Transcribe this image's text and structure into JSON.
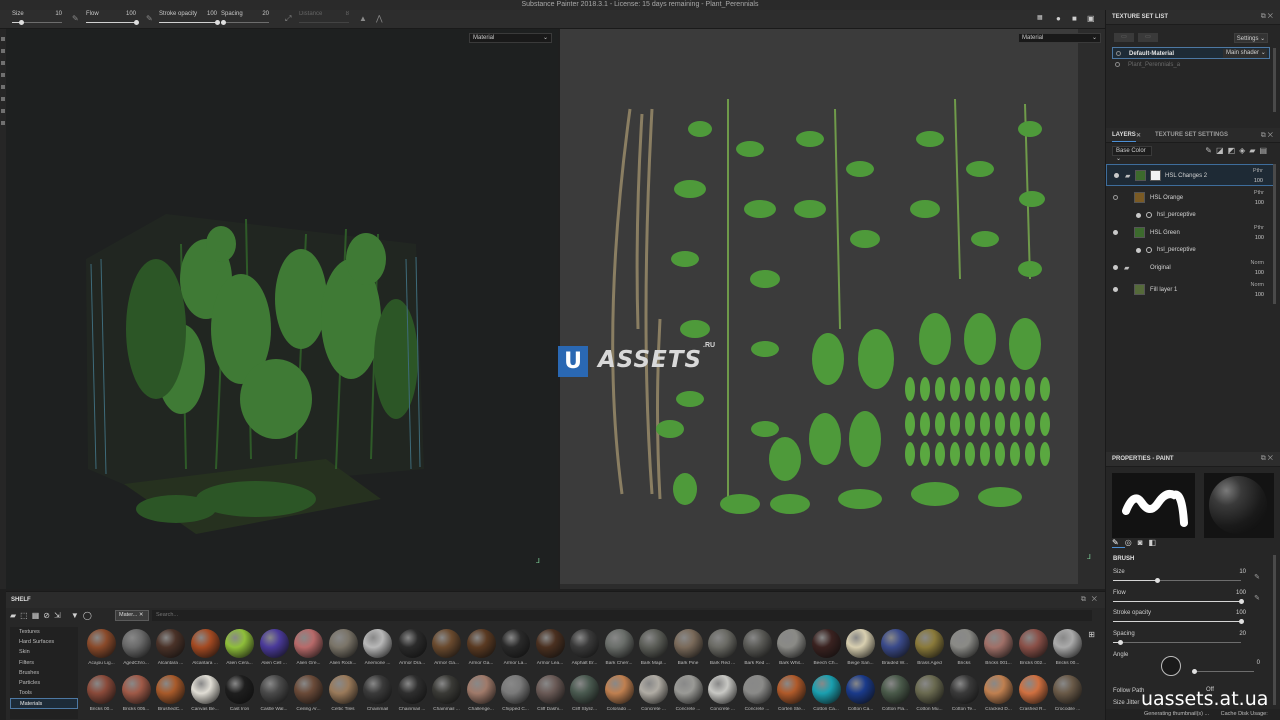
{
  "window": {
    "title": "Substance Painter 2018.3.1 - License: 15 days remaining - Plant_Perennials"
  },
  "toolbar": {
    "size": {
      "label": "Size",
      "value": "10",
      "fraction": 0.18
    },
    "flow": {
      "label": "Flow",
      "value": "100",
      "fraction": 1.0
    },
    "stroke_opacity": {
      "label": "Stroke opacity",
      "value": "100",
      "fraction": 1.0
    },
    "spacing": {
      "label": "Spacing",
      "value": "20",
      "fraction": 0.06
    },
    "distance": {
      "label": "Distance",
      "value": "8"
    }
  },
  "viewport3d": {
    "mode": "Material"
  },
  "viewport2d": {
    "mode": "Material"
  },
  "watermark": {
    "letter": "U",
    "text": "ASSETS",
    "suffix": ".RU"
  },
  "texture_set_list": {
    "title": "TEXTURE SET LIST",
    "settings_label": "Settings",
    "items": [
      {
        "name": "Default-Material",
        "shader": "Main shader",
        "selected": true
      },
      {
        "name": "Plant_Perennials_a",
        "selected": false
      }
    ]
  },
  "tabs": {
    "layers": "LAYERS",
    "texture_set_settings": "TEXTURE SET SETTINGS"
  },
  "layers": {
    "channel": "Base Color",
    "items": [
      {
        "name": "HSL Changes 2",
        "blend": "Pthr",
        "opacity": "100"
      },
      {
        "name": "HSL Orange",
        "blend": "Pthr",
        "opacity": "100"
      },
      {
        "name": "hsl_perceptive"
      },
      {
        "name": "HSL Green",
        "blend": "Pthr",
        "opacity": "100"
      },
      {
        "name": "hsl_perceptive"
      },
      {
        "name": "Original",
        "blend": "Norm",
        "opacity": "100"
      },
      {
        "name": "Fill layer 1",
        "blend": "Norm",
        "opacity": "100"
      }
    ]
  },
  "properties": {
    "title": "PROPERTIES - PAINT",
    "brush_section": "BRUSH",
    "size": {
      "label": "Size",
      "value": "10",
      "fraction": 0.35
    },
    "flow": {
      "label": "Flow",
      "value": "100",
      "fraction": 1.0
    },
    "stroke_opacity": {
      "label": "Stroke opacity",
      "value": "100",
      "fraction": 1.0
    },
    "spacing": {
      "label": "Spacing",
      "value": "20",
      "fraction": 0.06
    },
    "angle": {
      "label": "Angle",
      "value": "0"
    },
    "follow_path": "Follow Path",
    "off": "Off",
    "size_jitter": "Size Jitter"
  },
  "status": {
    "generating": "Generating thumbnail(s) ...",
    "cache": "Cache Disk Usage:"
  },
  "shelf": {
    "title": "SHELF",
    "filter_chip": "Mater...",
    "search_placeholder": "Search...",
    "categories": [
      "Textures",
      "Hard Surfaces",
      "Skin",
      "Filters",
      "Brushes",
      "Particles",
      "Tools",
      "Materials"
    ],
    "selected_category": "Materials",
    "materials": [
      {
        "name": "Acajou Lig...",
        "color": "#8a4a2a"
      },
      {
        "name": "AgedChro...",
        "color": "#6a6a6a"
      },
      {
        "name": "Alcantara ...",
        "color": "#4a3228"
      },
      {
        "name": "Alcantara ...",
        "color": "#a44a22"
      },
      {
        "name": "Alien Cera...",
        "color": "#8fbf3a"
      },
      {
        "name": "Alien Cell ...",
        "color": "#4a3a9a"
      },
      {
        "name": "Alien Gre...",
        "color": "#b86a6a"
      },
      {
        "name": "Alien Rock...",
        "color": "#7a7468"
      },
      {
        "name": "Anemone ...",
        "color": "#b8b8b8"
      },
      {
        "name": "Armor Dra...",
        "color": "#2a2a2a"
      },
      {
        "name": "Armor Ga...",
        "color": "#6a4a2e"
      },
      {
        "name": "Armor Ga...",
        "color": "#5a3a22"
      },
      {
        "name": "Armor La...",
        "color": "#2a2a2a"
      },
      {
        "name": "Armor Lea...",
        "color": "#4a3020"
      },
      {
        "name": "Asphalt Er...",
        "color": "#3a3a3a"
      },
      {
        "name": "Bark Cherr...",
        "color": "#6a6e6a"
      },
      {
        "name": "Bark Mapl...",
        "color": "#5c5e58"
      },
      {
        "name": "Bark Pine",
        "color": "#7a6a5a"
      },
      {
        "name": "Bark Red ...",
        "color": "#6a6a64"
      },
      {
        "name": "Bark Red ...",
        "color": "#5a5a56"
      },
      {
        "name": "Bark Whit...",
        "color": "#8a8a86"
      },
      {
        "name": "Beech Ch...",
        "color": "#3a2220"
      },
      {
        "name": "Beige San...",
        "color": "#d8cfb0"
      },
      {
        "name": "Braided W...",
        "color": "#3a4a8a"
      },
      {
        "name": "Brass Aged",
        "color": "#8a7a3a"
      },
      {
        "name": "Bricks",
        "color": "#8a8a86"
      },
      {
        "name": "Bricks 001...",
        "color": "#a07068"
      },
      {
        "name": "Bricks 002...",
        "color": "#8a5048"
      },
      {
        "name": "Bricks 00...",
        "color": "#aaaaaa"
      },
      {
        "name": "Bricks 00...",
        "color": "#8a4a3a"
      },
      {
        "name": "Bricks 005...",
        "color": "#a05a48"
      },
      {
        "name": "BrushedC...",
        "color": "#a85a2a"
      },
      {
        "name": "Canvas Be...",
        "color": "#e0ddd4"
      },
      {
        "name": "Cast Iron",
        "color": "#1e1e1e"
      },
      {
        "name": "Castle Wal...",
        "color": "#4a4a4a"
      },
      {
        "name": "Ceiling Ar...",
        "color": "#6a4a38"
      },
      {
        "name": "Celtic Tiles",
        "color": "#9a7a5a"
      },
      {
        "name": "Chainmail",
        "color": "#3a3a3a"
      },
      {
        "name": "Chainmail ...",
        "color": "#2e2e2e"
      },
      {
        "name": "Chainmail ...",
        "color": "#3a3a36"
      },
      {
        "name": "Challenge...",
        "color": "#a07a6a"
      },
      {
        "name": "Chipped C...",
        "color": "#7a7a7a"
      },
      {
        "name": "Cliff Dashi...",
        "color": "#6a5a56"
      },
      {
        "name": "Cliff Styliz...",
        "color": "#4a5a50"
      },
      {
        "name": "Colorado ...",
        "color": "#c08050"
      },
      {
        "name": "Concrete ...",
        "color": "#b0aca4"
      },
      {
        "name": "Concrete ...",
        "color": "#9a9a96"
      },
      {
        "name": "Concrete ...",
        "color": "#c8c8c4"
      },
      {
        "name": "Concrete ...",
        "color": "#8a8a88"
      },
      {
        "name": "Corten Ste...",
        "color": "#b05a2a"
      },
      {
        "name": "Cotton Ca...",
        "color": "#1aa0b0"
      },
      {
        "name": "Cotton Ca...",
        "color": "#1a3a8a"
      },
      {
        "name": "Cotton Fla...",
        "color": "#4a5a4a"
      },
      {
        "name": "Cotton Mu...",
        "color": "#6a6a50"
      },
      {
        "name": "Cotton Te...",
        "color": "#3a3a3a"
      },
      {
        "name": "Cracked D...",
        "color": "#c08050"
      },
      {
        "name": "Crashed R...",
        "color": "#d07040"
      },
      {
        "name": "Crocodile ...",
        "color": "#6a5a48"
      }
    ]
  }
}
